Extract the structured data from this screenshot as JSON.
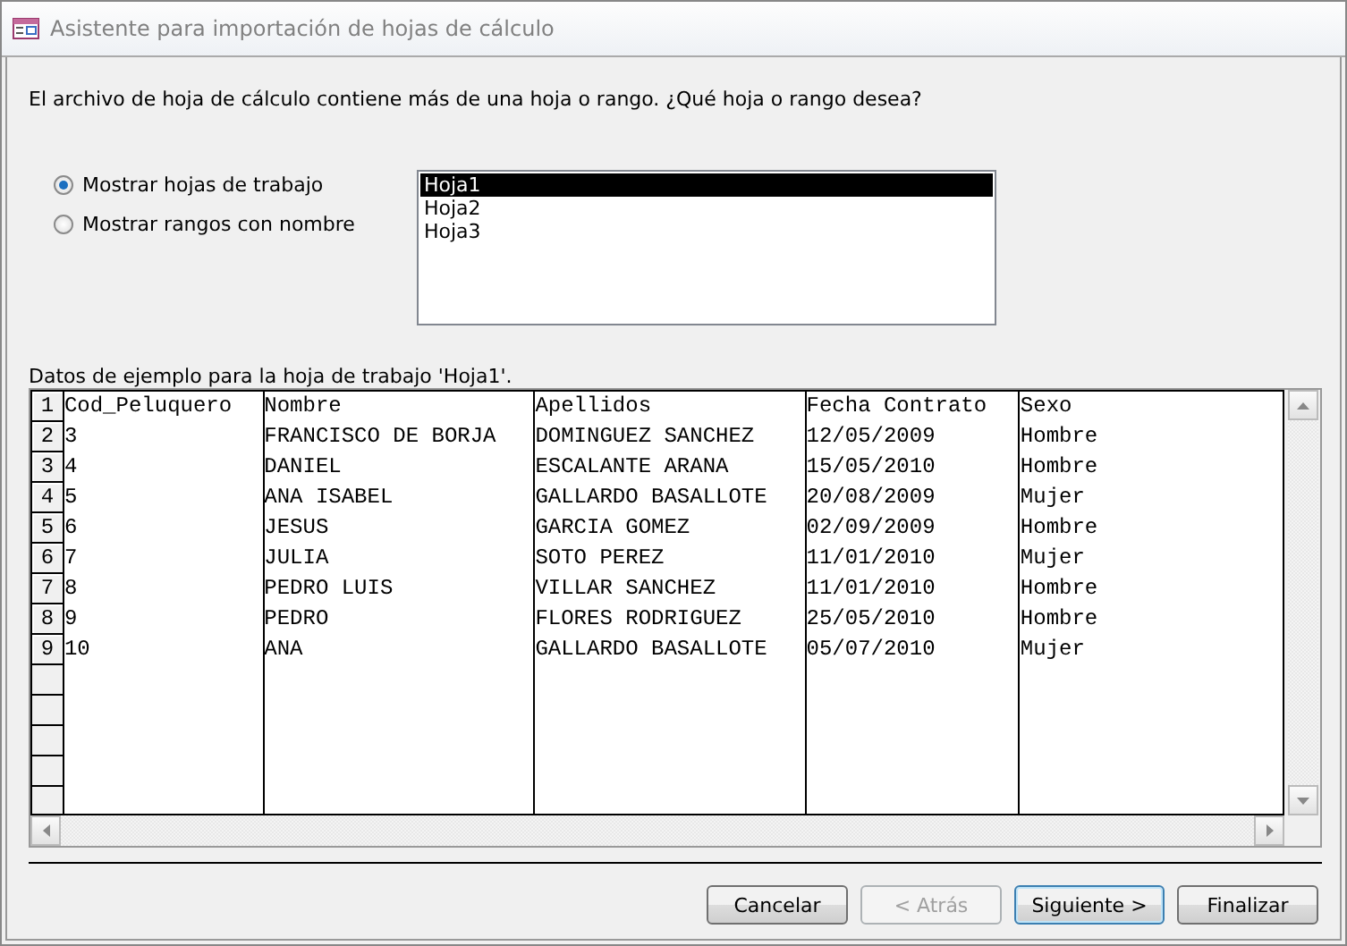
{
  "window": {
    "title": "Asistente para importación de hojas de cálculo"
  },
  "prompt": "El archivo de hoja de cálculo contiene más de una hoja o rango. ¿Qué hoja o rango desea?",
  "options": [
    {
      "label": "Mostrar hojas de trabajo",
      "selected": true
    },
    {
      "label": "Mostrar rangos con nombre",
      "selected": false
    }
  ],
  "sheets": [
    {
      "label": "Hoja1",
      "selected": true
    },
    {
      "label": "Hoja2",
      "selected": false
    },
    {
      "label": "Hoja3",
      "selected": false
    }
  ],
  "preview": {
    "caption": "Datos de ejemplo para la hoja de trabajo 'Hoja1'.",
    "rows": [
      {
        "number": "1",
        "cells": [
          "Cod_Peluquero",
          "Nombre",
          "Apellidos",
          "Fecha Contrato",
          "Sexo"
        ]
      },
      {
        "number": "2",
        "cells": [
          "3",
          "FRANCISCO DE BORJA",
          "DOMINGUEZ SANCHEZ",
          "12/05/2009",
          "Hombre"
        ]
      },
      {
        "number": "3",
        "cells": [
          "4",
          "DANIEL",
          "ESCALANTE ARANA",
          "15/05/2010",
          "Hombre"
        ]
      },
      {
        "number": "4",
        "cells": [
          "5",
          "ANA ISABEL",
          "GALLARDO BASALLOTE",
          "20/08/2009",
          "Mujer"
        ]
      },
      {
        "number": "5",
        "cells": [
          "6",
          "JESUS",
          "GARCIA GOMEZ",
          "02/09/2009",
          "Hombre"
        ]
      },
      {
        "number": "6",
        "cells": [
          "7",
          "JULIA",
          "SOTO PEREZ",
          "11/01/2010",
          "Mujer"
        ]
      },
      {
        "number": "7",
        "cells": [
          "8",
          "PEDRO LUIS",
          "VILLAR SANCHEZ",
          "11/01/2010",
          "Hombre"
        ]
      },
      {
        "number": "8",
        "cells": [
          "9",
          "PEDRO",
          "FLORES RODRIGUEZ",
          "25/05/2010",
          "Hombre"
        ]
      },
      {
        "number": "9",
        "cells": [
          "10",
          "ANA",
          "GALLARDO BASALLOTE",
          "05/07/2010",
          "Mujer"
        ]
      }
    ]
  },
  "buttons": [
    {
      "label": "Cancelar",
      "disabled": false,
      "default": false
    },
    {
      "label": "< Atrás",
      "disabled": true,
      "default": false
    },
    {
      "label": "Siguiente >",
      "disabled": false,
      "default": true
    },
    {
      "label": "Finalizar",
      "disabled": false,
      "default": false
    }
  ]
}
